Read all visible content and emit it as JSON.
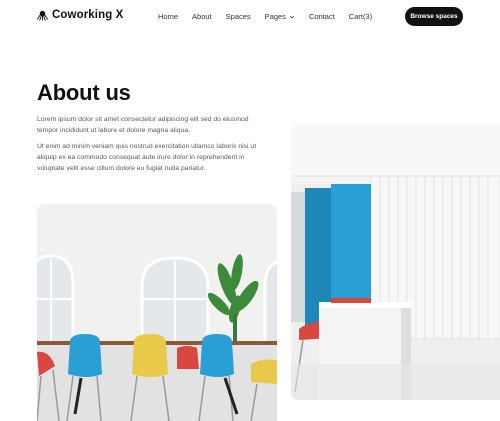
{
  "brand": {
    "name": "Coworking X",
    "logo_icon": "octopus-icon"
  },
  "nav": {
    "items": [
      {
        "label": "Home"
      },
      {
        "label": "About"
      },
      {
        "label": "Spaces"
      },
      {
        "label": "Pages",
        "has_dropdown": true
      },
      {
        "label": "Contact"
      },
      {
        "label": "Cart(3)"
      }
    ],
    "cta_label": "Browse spaces"
  },
  "hero": {
    "title": "About us",
    "paragraph_1": "Lorem ipsum dolor sit amet consectetur adipiscing elit sed do eiusmod tempor incididunt ut labore et dolore magna aliqua.",
    "paragraph_2": "Ut enim ad minim veniam quis nostrud exercitation ullamco laboris nisi ut aliquip ex ea commodo consequat aute irure dolor in reprehenderit in voluptate velit esse cillum dolore eu fugiat nulla pariatur."
  },
  "colors": {
    "cta_bg": "#111111",
    "accent_blue": "#2a9fd6",
    "accent_yellow": "#e8c94a",
    "accent_red": "#d9473f"
  }
}
